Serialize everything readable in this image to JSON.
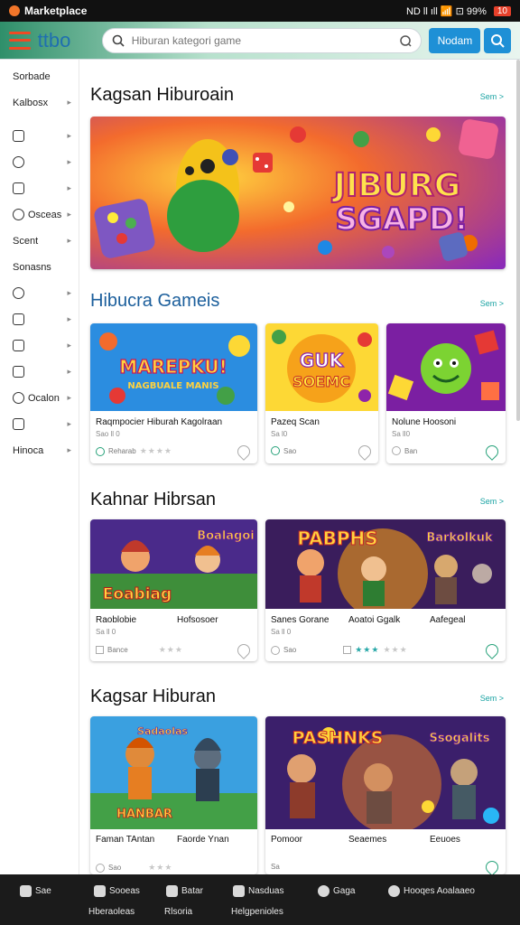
{
  "status": {
    "app_name": "Marketplace",
    "right_text": "ND ll ıll 📶 ⊡ 99%",
    "battery": "10"
  },
  "header": {
    "logo": "ttbo",
    "search_placeholder": "Hiburan kategori game",
    "search_button": "Nodam"
  },
  "sidebar": {
    "items": [
      {
        "label": "Sorbade",
        "chev": false,
        "icon": false
      },
      {
        "label": "Kalbosx",
        "chev": true,
        "icon": false
      },
      {
        "label": "",
        "chev": true,
        "icon": true
      },
      {
        "label": "",
        "chev": true,
        "icon": true
      },
      {
        "label": "",
        "chev": true,
        "icon": true
      },
      {
        "label": "Osceas",
        "chev": true,
        "icon": true
      },
      {
        "label": "Scent",
        "chev": true,
        "icon": false
      },
      {
        "label": "Sonasns",
        "chev": false,
        "icon": false
      },
      {
        "label": "",
        "chev": true,
        "icon": true
      },
      {
        "label": "",
        "chev": true,
        "icon": true
      },
      {
        "label": "",
        "chev": true,
        "icon": true
      },
      {
        "label": "",
        "chev": true,
        "icon": true
      },
      {
        "label": "Ocalon",
        "chev": true,
        "icon": true
      },
      {
        "label": "",
        "chev": true,
        "icon": true
      },
      {
        "label": "Hinoca",
        "chev": true,
        "icon": false
      }
    ]
  },
  "sections": [
    {
      "title": "Kagsan Hiburoain",
      "see_all": "Sem >"
    },
    {
      "title": "Hibucra Gameis",
      "see_all": "Sem >"
    },
    {
      "title": "Kahnar Hibrsan",
      "see_all": "Sem >"
    },
    {
      "title": "Kagsar Hiburan",
      "see_all": "Sem >"
    }
  ],
  "banner": {
    "text_line1": "JIBURG",
    "text_line2": "SGAPD!"
  },
  "row1": [
    {
      "art_title": "MAREPKU!",
      "art_sub": "NAGBUALE MANIS",
      "title": "Raqmpocier Hiburah Kagolraan",
      "sub": "Sao ll 0",
      "meta": "Reharab",
      "stars": "★★★★"
    },
    {
      "art_title": "GUK",
      "art_sub": "SOEMC",
      "title": "Pazeq Scan",
      "sub": "Sa l0",
      "meta": "Sao",
      "stars": ""
    },
    {
      "art_title": "",
      "art_sub": "",
      "title": "Nolune Hoosoni",
      "sub": "Sa ll0",
      "meta": "Ban",
      "stars": ""
    }
  ],
  "row2": [
    {
      "art_title": "Eoabiag",
      "art_badge": "Boalagoi",
      "title": "Raoblobie",
      "title2": "Hofsosoer",
      "sub": "Sa ll 0",
      "meta": "Bance",
      "stars": "★★★"
    },
    {
      "art_title": "PABPHS",
      "art_badge": "Barkolkuk",
      "title": "Sanes Gorane",
      "title2": "Aoatoi Ggalk",
      "title3": "Aafegeal",
      "sub": "Sa ll 0",
      "meta": "Sao",
      "stars": "★★★",
      "stars2": "★★★"
    }
  ],
  "row3": [
    {
      "art_title": "HANBAR",
      "art_badge": "Sadaolas",
      "title": "Faman TAntan",
      "title2": "Faorde Ynan",
      "sub": "Sao",
      "stars": "★★★"
    },
    {
      "art_title": "PASHNKS",
      "art_badge": "Ssogalits",
      "title": "Pomoor",
      "title2": "Seaemes",
      "title3": "Eeuoes",
      "sub": "Sa",
      "stars": ""
    }
  ],
  "bottom_nav": [
    {
      "label": "Sae",
      "sub": ""
    },
    {
      "label": "Sooeas",
      "sub": "Hberaoleas"
    },
    {
      "label": "Batar",
      "sub": "Rlsoria"
    },
    {
      "label": "Nasduas",
      "sub": "Helgpenioles"
    },
    {
      "label": "Gaga",
      "sub": ""
    },
    {
      "label": "Hooqes Aoalaaeo",
      "sub": ""
    }
  ],
  "colors": {
    "accent": "#1e90d6",
    "menu": "#f04a24",
    "teal": "#1aa3a3"
  }
}
